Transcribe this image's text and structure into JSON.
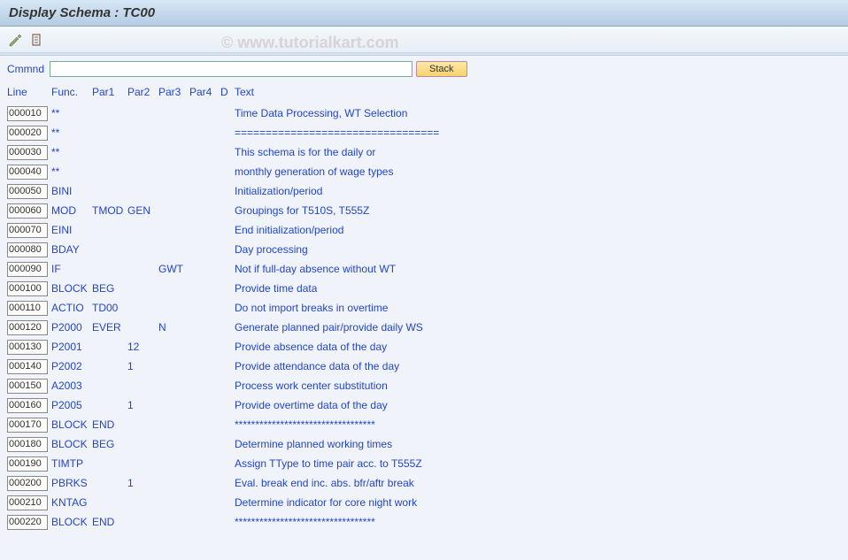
{
  "title": "Display Schema : TC00",
  "watermark": "© www.tutorialkart.com",
  "command": {
    "label": "Cmmnd",
    "value": "",
    "stack_label": "Stack"
  },
  "columns": {
    "line": "Line",
    "func": "Func.",
    "par1": "Par1",
    "par2": "Par2",
    "par3": "Par3",
    "par4": "Par4",
    "d": "D",
    "text": "Text"
  },
  "rows": [
    {
      "line": "000010",
      "func": "**",
      "par1": "",
      "par2": "",
      "par3": "",
      "par4": "",
      "d": "",
      "text": "Time Data Processing, WT Selection"
    },
    {
      "line": "000020",
      "func": "**",
      "par1": "",
      "par2": "",
      "par3": "",
      "par4": "",
      "d": "",
      "text": "================================="
    },
    {
      "line": "000030",
      "func": "**",
      "par1": "",
      "par2": "",
      "par3": "",
      "par4": "",
      "d": "",
      "text": "This schema is for the daily or"
    },
    {
      "line": "000040",
      "func": "**",
      "par1": "",
      "par2": "",
      "par3": "",
      "par4": "",
      "d": "",
      "text": "monthly generation of wage types"
    },
    {
      "line": "000050",
      "func": "BINI",
      "par1": "",
      "par2": "",
      "par3": "",
      "par4": "",
      "d": "",
      "text": "Initialization/period"
    },
    {
      "line": "000060",
      "func": "MOD",
      "par1": "TMOD",
      "par2": "GEN",
      "par3": "",
      "par4": "",
      "d": "",
      "text": "Groupings for T510S, T555Z"
    },
    {
      "line": "000070",
      "func": "EINI",
      "par1": "",
      "par2": "",
      "par3": "",
      "par4": "",
      "d": "",
      "text": "End initialization/period"
    },
    {
      "line": "000080",
      "func": "BDAY",
      "par1": "",
      "par2": "",
      "par3": "",
      "par4": "",
      "d": "",
      "text": "Day processing"
    },
    {
      "line": "000090",
      "func": "IF",
      "par1": "",
      "par2": "",
      "par3": "GWT",
      "par4": "",
      "d": "",
      "text": "Not if full-day absence without WT"
    },
    {
      "line": "000100",
      "func": "BLOCK",
      "par1": "BEG",
      "par2": "",
      "par3": "",
      "par4": "",
      "d": "",
      "text": "Provide time data"
    },
    {
      "line": "000110",
      "func": "ACTIO",
      "par1": "TD00",
      "par2": "",
      "par3": "",
      "par4": "",
      "d": "",
      "text": "Do not import breaks in overtime"
    },
    {
      "line": "000120",
      "func": "P2000",
      "par1": "EVER",
      "par2": "",
      "par3": "N",
      "par4": "",
      "d": "",
      "text": "Generate planned pair/provide daily WS"
    },
    {
      "line": "000130",
      "func": "P2001",
      "par1": "",
      "par2": "12",
      "par3": "",
      "par4": "",
      "d": "",
      "text": "Provide absence data of the day"
    },
    {
      "line": "000140",
      "func": "P2002",
      "par1": "",
      "par2": "1",
      "par3": "",
      "par4": "",
      "d": "",
      "text": "Provide attendance data of the day"
    },
    {
      "line": "000150",
      "func": "A2003",
      "par1": "",
      "par2": "",
      "par3": "",
      "par4": "",
      "d": "",
      "text": "Process work center substitution"
    },
    {
      "line": "000160",
      "func": "P2005",
      "par1": "",
      "par2": "1",
      "par3": "",
      "par4": "",
      "d": "",
      "text": "Provide overtime data of the day"
    },
    {
      "line": "000170",
      "func": "BLOCK",
      "par1": "END",
      "par2": "",
      "par3": "",
      "par4": "",
      "d": "",
      "text": "**********************************"
    },
    {
      "line": "000180",
      "func": "BLOCK",
      "par1": "BEG",
      "par2": "",
      "par3": "",
      "par4": "",
      "d": "",
      "text": "Determine planned working times"
    },
    {
      "line": "000190",
      "func": "TIMTP",
      "par1": "",
      "par2": "",
      "par3": "",
      "par4": "",
      "d": "",
      "text": "Assign TType to time pair acc. to T555Z"
    },
    {
      "line": "000200",
      "func": "PBRKS",
      "par1": "",
      "par2": "1",
      "par3": "",
      "par4": "",
      "d": "",
      "text": "Eval. break end inc. abs. bfr/aftr break"
    },
    {
      "line": "000210",
      "func": "KNTAG",
      "par1": "",
      "par2": "",
      "par3": "",
      "par4": "",
      "d": "",
      "text": "Determine indicator for core night work"
    },
    {
      "line": "000220",
      "func": "BLOCK",
      "par1": "END",
      "par2": "",
      "par3": "",
      "par4": "",
      "d": "",
      "text": "**********************************"
    }
  ]
}
